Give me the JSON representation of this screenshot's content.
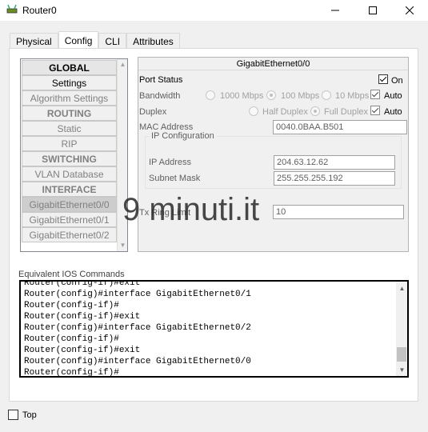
{
  "window": {
    "title": "Router0",
    "icon": "router-icon",
    "controls": [
      "minimize-icon",
      "maximize-icon",
      "close-icon"
    ]
  },
  "tabs": [
    {
      "label": "Physical",
      "active": false
    },
    {
      "label": "Config",
      "active": true
    },
    {
      "label": "CLI",
      "active": false
    },
    {
      "label": "Attributes",
      "active": false
    }
  ],
  "sidebar": {
    "items": [
      {
        "label": "GLOBAL",
        "header": true,
        "enabled": true
      },
      {
        "label": "Settings",
        "header": false,
        "enabled": true
      },
      {
        "label": "Algorithm Settings",
        "header": false,
        "enabled": false
      },
      {
        "label": "ROUTING",
        "header": true,
        "enabled": false
      },
      {
        "label": "Static",
        "header": false,
        "enabled": false
      },
      {
        "label": "RIP",
        "header": false,
        "enabled": false
      },
      {
        "label": "SWITCHING",
        "header": true,
        "enabled": false
      },
      {
        "label": "VLAN Database",
        "header": false,
        "enabled": false
      },
      {
        "label": "INTERFACE",
        "header": true,
        "enabled": false
      },
      {
        "label": "GigabitEthernet0/0",
        "header": false,
        "enabled": false,
        "selected": true
      },
      {
        "label": "GigabitEthernet0/1",
        "header": false,
        "enabled": false
      },
      {
        "label": "GigabitEthernet0/2",
        "header": false,
        "enabled": false
      }
    ]
  },
  "interface": {
    "title": "GigabitEthernet0/0",
    "port_status_label": "Port Status",
    "port_status_on_label": "On",
    "port_status_on": true,
    "bandwidth_label": "Bandwidth",
    "bandwidth_options": [
      "1000 Mbps",
      "100 Mbps",
      "10 Mbps"
    ],
    "bandwidth_selected": "100 Mbps",
    "bandwidth_auto_label": "Auto",
    "bandwidth_auto": true,
    "duplex_label": "Duplex",
    "duplex_options": [
      "Half Duplex",
      "Full Duplex"
    ],
    "duplex_selected": "Full Duplex",
    "duplex_auto_label": "Auto",
    "duplex_auto": true,
    "mac_label": "MAC Address",
    "mac_value": "0040.0BAA.B501",
    "ip_config_legend": "IP Configuration",
    "ip_label": "IP Address",
    "ip_value": "204.63.12.62",
    "mask_label": "Subnet Mask",
    "mask_value": "255.255.255.192",
    "tx_label": "Tx Ring Limit",
    "tx_value": "10"
  },
  "console": {
    "label": "Equivalent IOS Commands",
    "lines": [
      "Router(config-if)#exit",
      "Router(config)#interface GigabitEthernet0/1",
      "Router(config-if)#",
      "Router(config-if)#exit",
      "Router(config)#interface GigabitEthernet0/2",
      "Router(config-if)#",
      "Router(config-if)#exit",
      "Router(config)#interface GigabitEthernet0/0",
      "Router(config-if)#"
    ]
  },
  "footer": {
    "top_label": "Top",
    "top_checked": false
  },
  "watermark": "9 minuti.it"
}
